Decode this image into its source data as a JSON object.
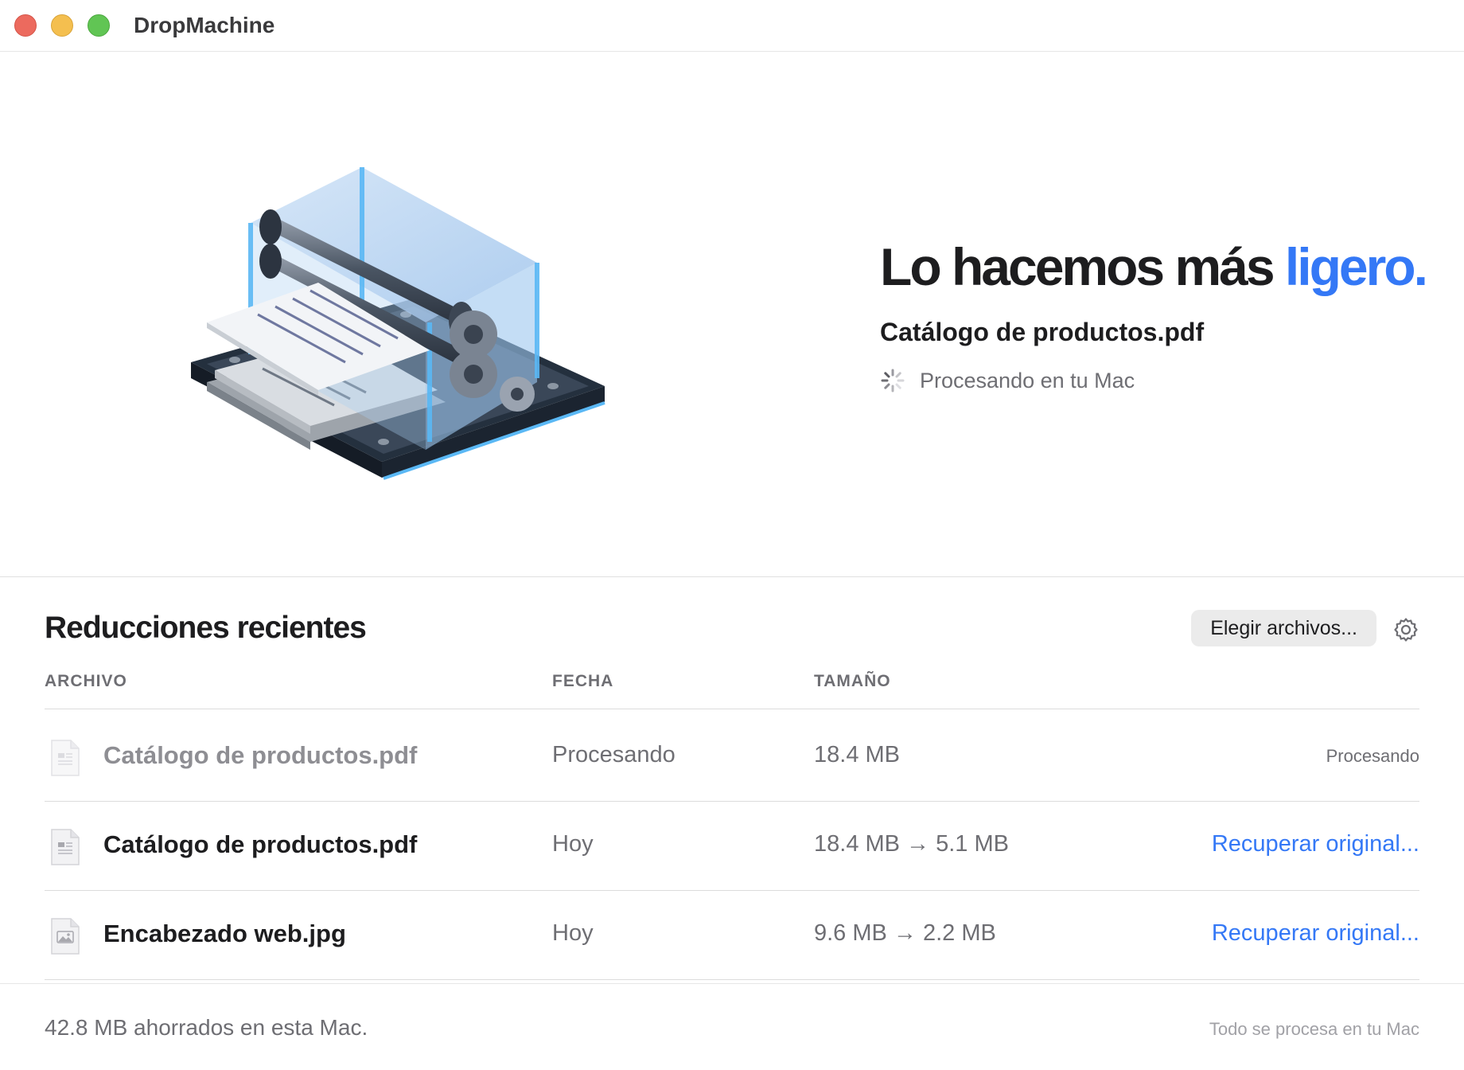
{
  "window": {
    "title": "DropMachine"
  },
  "hero": {
    "headline_prefix": "Lo hacemos más",
    "headline_accent": "ligero.",
    "current_file": "Catálogo de productos.pdf",
    "status": "Procesando en tu Mac",
    "accent_color": "#3478f6",
    "illustration_icon": "compression-machine-illustration"
  },
  "recent": {
    "title": "Reducciones recientes",
    "choose_button": "Elegir archivos...",
    "settings_icon": "gear-icon",
    "columns": {
      "file": "ARCHIVO",
      "date": "FECHA",
      "size": "TAMAÑO"
    },
    "rows": [
      {
        "name": "Catálogo de productos.pdf",
        "date": "Procesando",
        "size": "18.4 MB",
        "action": "Procesando",
        "icon": "pdf-document-icon",
        "state": "processing"
      },
      {
        "name": "Catálogo de productos.pdf",
        "date": "Hoy",
        "size": "18.4 MB → 5.1 MB",
        "action": "Recuperar original...",
        "icon": "pdf-document-icon",
        "state": "done"
      },
      {
        "name": "Encabezado web.jpg",
        "date": "Hoy",
        "size": "9.6 MB → 2.2 MB",
        "action": "Recuperar original...",
        "icon": "image-document-icon",
        "state": "done"
      }
    ]
  },
  "footer": {
    "saved": "42.8 MB ahorrados en esta Mac.",
    "privacy": "Todo se procesa en tu Mac"
  }
}
